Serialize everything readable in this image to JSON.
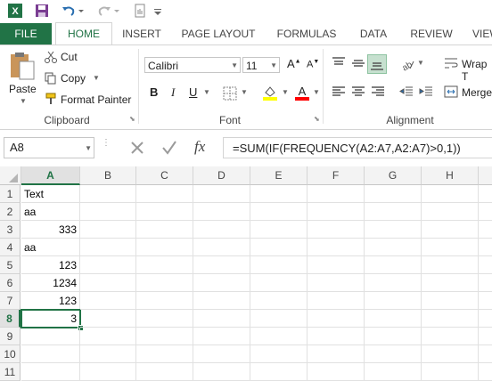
{
  "quick_access": {
    "icons": [
      "excel-icon",
      "save-icon",
      "undo-icon",
      "redo-icon",
      "touch-mode-icon",
      "customize-icon"
    ]
  },
  "tabs": [
    {
      "label": "FILE"
    },
    {
      "label": "HOME"
    },
    {
      "label": "INSERT"
    },
    {
      "label": "PAGE LAYOUT"
    },
    {
      "label": "FORMULAS"
    },
    {
      "label": "DATA"
    },
    {
      "label": "REVIEW"
    },
    {
      "label": "VIEW"
    }
  ],
  "clipboard": {
    "paste": "Paste",
    "cut": "Cut",
    "copy": "Copy",
    "format_painter": "Format Painter",
    "group_label": "Clipboard"
  },
  "font": {
    "name": "Calibri",
    "size": "11",
    "bold": "B",
    "italic": "I",
    "underline": "U",
    "group_label": "Font",
    "highlight_color": "#FFFF00",
    "font_color": "#FF0000"
  },
  "alignment": {
    "wrap_text": "Wrap T",
    "merge": "Merge",
    "group_label": "Alignment"
  },
  "formula_bar": {
    "name_box": "A8",
    "fx": "fx",
    "formula": "=SUM(IF(FREQUENCY(A2:A7,A2:A7)>0,1))"
  },
  "grid": {
    "columns": [
      "A",
      "B",
      "C",
      "D",
      "E",
      "F",
      "G",
      "H"
    ],
    "rows": [
      "1",
      "2",
      "3",
      "4",
      "5",
      "6",
      "7",
      "8",
      "9",
      "10",
      "11"
    ],
    "cells": [
      "Text",
      "aa",
      "333",
      "aa",
      "123",
      "1234",
      "123",
      "3"
    ]
  },
  "colors": {
    "accent": "#217346"
  }
}
